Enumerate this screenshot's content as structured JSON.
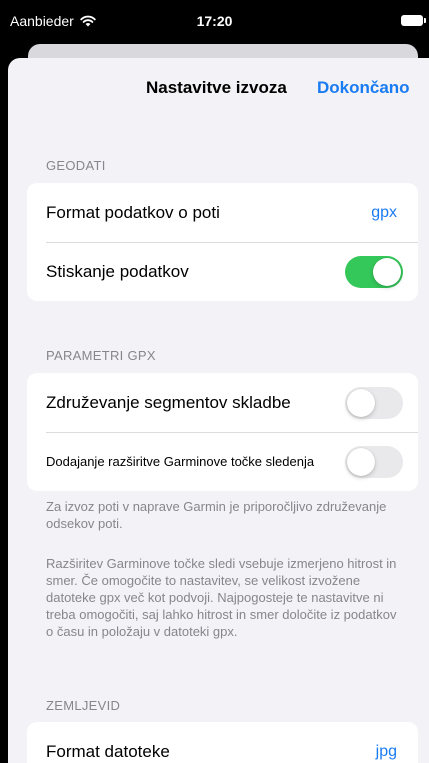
{
  "status_bar": {
    "carrier": "Aanbieder",
    "time": "17:20"
  },
  "nav": {
    "title": "Nastavitve izvoza",
    "done_label": "Dokončano"
  },
  "geodata": {
    "header": "GEODATI",
    "format_label": "Format podatkov o poti",
    "format_value": "gpx",
    "compress_label": "Stiskanje podatkov",
    "compress_on": true
  },
  "gpx_params": {
    "header": "PARAMETRI GPX",
    "merge_label": "Združevanje segmentov skladbe",
    "merge_on": false,
    "garmin_label": "Dodajanje razširitve Garminove točke sledenja",
    "garmin_on": false,
    "footer_1": "Za izvoz poti v naprave Garmin je priporočljivo združevanje odsekov poti.",
    "footer_2": "Razširitev Garminove točke sledi vsebuje izmerjeno hitrost in smer. Če omogočite to nastavitev, se velikost izvožene datoteke gpx več kot podvoji. Najpogosteje te nastavitve ni treba omogočiti, saj lahko hitrost in smer določite iz podatkov o času in položaju v datoteki gpx."
  },
  "map": {
    "header": "ZEMLJEVID",
    "format_label": "Format datoteke",
    "format_value": "jpg"
  },
  "colors": {
    "accent": "#1a7cf2",
    "toggle_on": "#34c759",
    "toggle_off": "#e9e9eb",
    "background": "#f2f2f7"
  }
}
